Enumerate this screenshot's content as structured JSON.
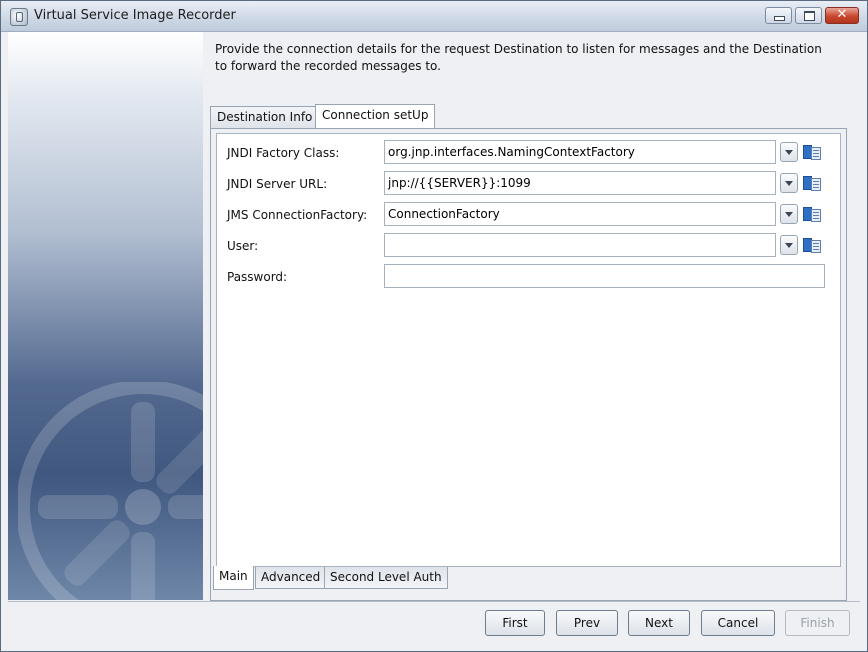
{
  "window": {
    "title": "Virtual Service Image Recorder"
  },
  "intro": "Provide the connection details for the request Destination to listen for messages and the Destination to forward the recorded messages to.",
  "tabs": [
    {
      "label": "Destination Info",
      "active": false
    },
    {
      "label": "Connection setUp",
      "active": true
    }
  ],
  "form": {
    "jndi_factory_class": {
      "label": "JNDI Factory Class:",
      "value": "org.jnp.interfaces.NamingContextFactory"
    },
    "jndi_server_url": {
      "label": "JNDI Server URL:",
      "value": "jnp://{{SERVER}}:1099"
    },
    "jms_connection_factory": {
      "label": "JMS ConnectionFactory:",
      "value": "ConnectionFactory"
    },
    "user": {
      "label": "User:",
      "value": ""
    },
    "password": {
      "label": "Password:",
      "value": ""
    }
  },
  "bottom_tabs": [
    {
      "label": "Main",
      "active": true
    },
    {
      "label": "Advanced",
      "active": false
    },
    {
      "label": "Second Level Auth",
      "active": false
    }
  ],
  "buttons": {
    "first": "First",
    "prev": "Prev",
    "next": "Next",
    "cancel": "Cancel",
    "finish": "Finish"
  },
  "icons": {
    "dropdown": "chevron-down-icon",
    "browse": "address-book-icon"
  },
  "colors": {
    "sidebar_dark": "#40577f",
    "close_button": "#c8472e"
  }
}
